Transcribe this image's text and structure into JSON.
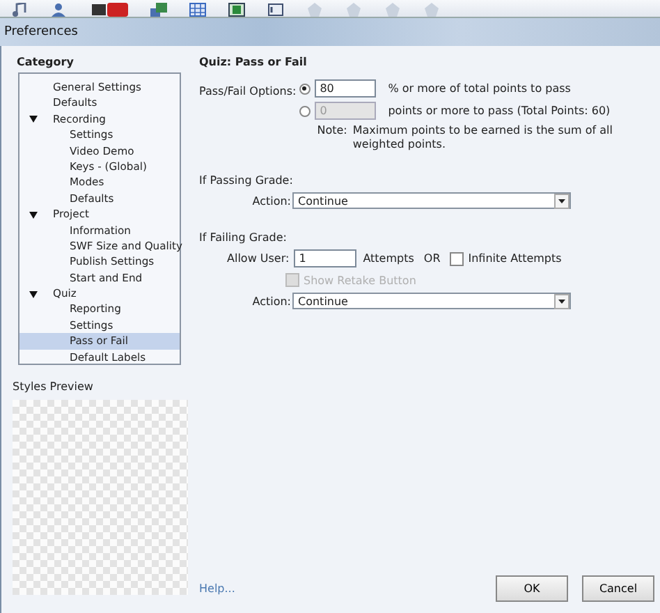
{
  "window": {
    "title": "Preferences"
  },
  "toolbar": [
    {
      "kind": "note"
    },
    {
      "kind": "person"
    },
    {
      "kind": "video"
    },
    {
      "kind": "layers"
    },
    {
      "kind": "grid"
    },
    {
      "kind": "film"
    },
    {
      "kind": "tag"
    },
    {
      "kind": "faded"
    },
    {
      "kind": "faded"
    },
    {
      "kind": "faded"
    },
    {
      "kind": "faded"
    }
  ],
  "sidebar": {
    "heading": "Category",
    "items": [
      {
        "label": "General Settings",
        "selected": false
      },
      {
        "label": "Defaults",
        "selected": false
      },
      {
        "label": "Recording",
        "expanded": true,
        "selected": false,
        "children": [
          {
            "label": "Settings",
            "selected": false
          },
          {
            "label": "Video Demo",
            "selected": false
          },
          {
            "label": "Keys - (Global)",
            "selected": false
          },
          {
            "label": "Modes",
            "selected": false
          },
          {
            "label": "Defaults",
            "selected": false
          }
        ]
      },
      {
        "label": "Project",
        "expanded": true,
        "selected": false,
        "children": [
          {
            "label": "Information",
            "selected": false
          },
          {
            "label": "SWF Size and Quality",
            "selected": false
          },
          {
            "label": "Publish Settings",
            "selected": false
          },
          {
            "label": "Start and End",
            "selected": false
          }
        ]
      },
      {
        "label": "Quiz",
        "expanded": true,
        "selected": false,
        "children": [
          {
            "label": "Reporting",
            "selected": false
          },
          {
            "label": "Settings",
            "selected": false
          },
          {
            "label": "Pass or Fail",
            "selected": true
          },
          {
            "label": "Default Labels",
            "selected": false
          }
        ]
      }
    ],
    "preview_heading": "Styles Preview"
  },
  "panel": {
    "title": "Quiz: Pass or Fail",
    "options_label": "Pass/Fail Options:",
    "options": [
      {
        "selected": true,
        "value": "80",
        "disabled": false,
        "text": "% or more of total points to pass"
      },
      {
        "selected": false,
        "value": "0",
        "disabled": true,
        "text": "points or more to pass (Total Points: 60)"
      }
    ],
    "note_label": "Note:",
    "note": "Maximum points to be earned is the sum of all weighted points.",
    "passing": {
      "heading": "If Passing Grade:",
      "action_label": "Action:",
      "action": "Continue"
    },
    "failing": {
      "heading": "If Failing Grade:",
      "allow_label": "Allow User:",
      "attempts": "1",
      "attempts_text": "Attempts",
      "or_text": "OR",
      "infinite": {
        "label": "Infinite Attempts",
        "checked": false,
        "disabled": false
      },
      "retake": {
        "label": "Show Retake Button",
        "checked": false,
        "disabled": true
      },
      "action_label": "Action:",
      "action": "Continue"
    }
  },
  "footer": {
    "help": "Help...",
    "buttons": [
      "OK",
      "Cancel"
    ]
  }
}
